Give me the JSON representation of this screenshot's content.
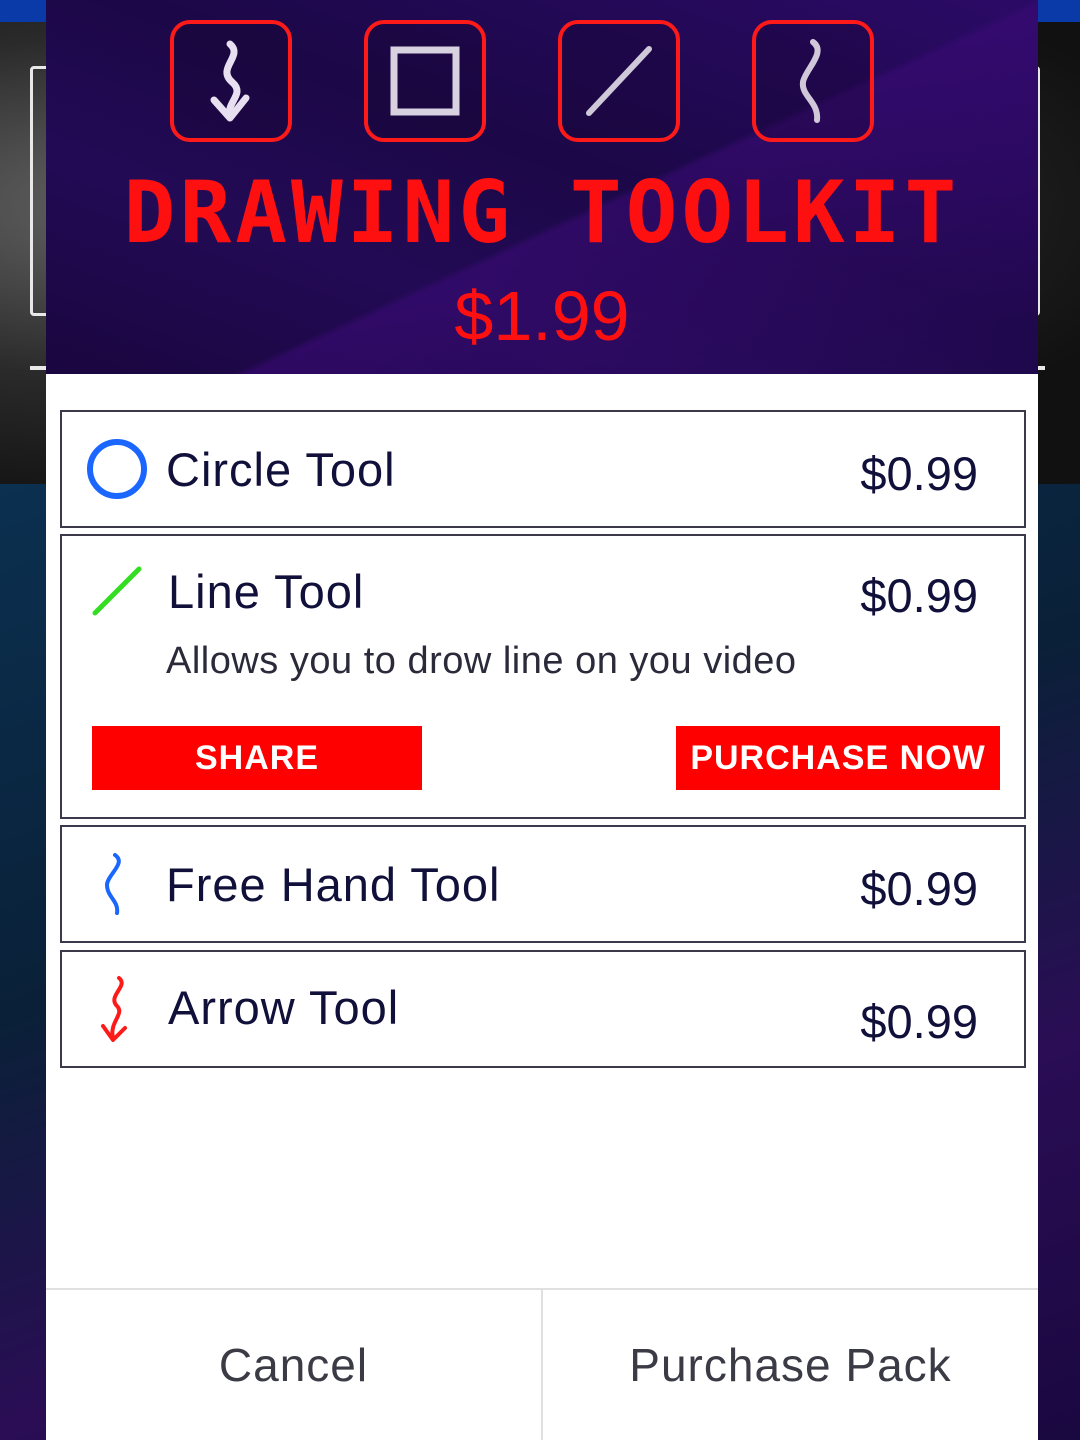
{
  "banner": {
    "title": "DRAWING TOOLKIT",
    "price": "$1.99",
    "icons": [
      "arrow-icon",
      "square-icon",
      "line-icon",
      "freehand-icon"
    ]
  },
  "tools": [
    {
      "name": "Circle Tool",
      "price": "$0.99",
      "icon": "circle-icon",
      "icon_color": "#1a66ff"
    },
    {
      "name": "Line Tool",
      "price": "$0.99",
      "icon": "line-icon",
      "icon_color": "#33dd22",
      "description": "Allows you to drow line on you video",
      "share_label": "SHARE",
      "purchase_label": "PURCHASE NOW"
    },
    {
      "name": "Free Hand Tool",
      "price": "$0.99",
      "icon": "freehand-icon",
      "icon_color": "#1a66ff"
    },
    {
      "name": "Arrow Tool",
      "price": "$0.99",
      "icon": "arrow-icon",
      "icon_color": "#ff1a1a"
    }
  ],
  "actions": {
    "cancel_label": "Cancel",
    "purchase_pack_label": "Purchase Pack"
  },
  "colors": {
    "accent_red": "#ff0000",
    "banner_bg": "#1c0848"
  }
}
